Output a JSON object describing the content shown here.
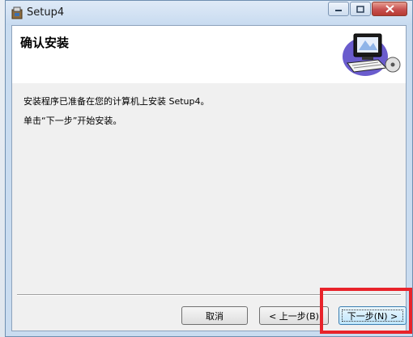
{
  "window": {
    "title": "Setup4",
    "app_icon": "installer-icon",
    "caption_buttons": [
      "minimize-icon",
      "maximize-icon",
      "close-icon"
    ]
  },
  "banner": {
    "title": "确认安装",
    "graphic": "computer-install-icon"
  },
  "body": {
    "line1": "安装程序已准备在您的计算机上安装 Setup4。",
    "line2": "单击“下一步”开始安装。"
  },
  "buttons": {
    "cancel": "取消",
    "back": "< 上一步(B)",
    "next": "下一步(N) >"
  },
  "colors": {
    "highlight": "#e8232a",
    "titlebar": "#c9dcf0",
    "close_button": "#c75050"
  }
}
